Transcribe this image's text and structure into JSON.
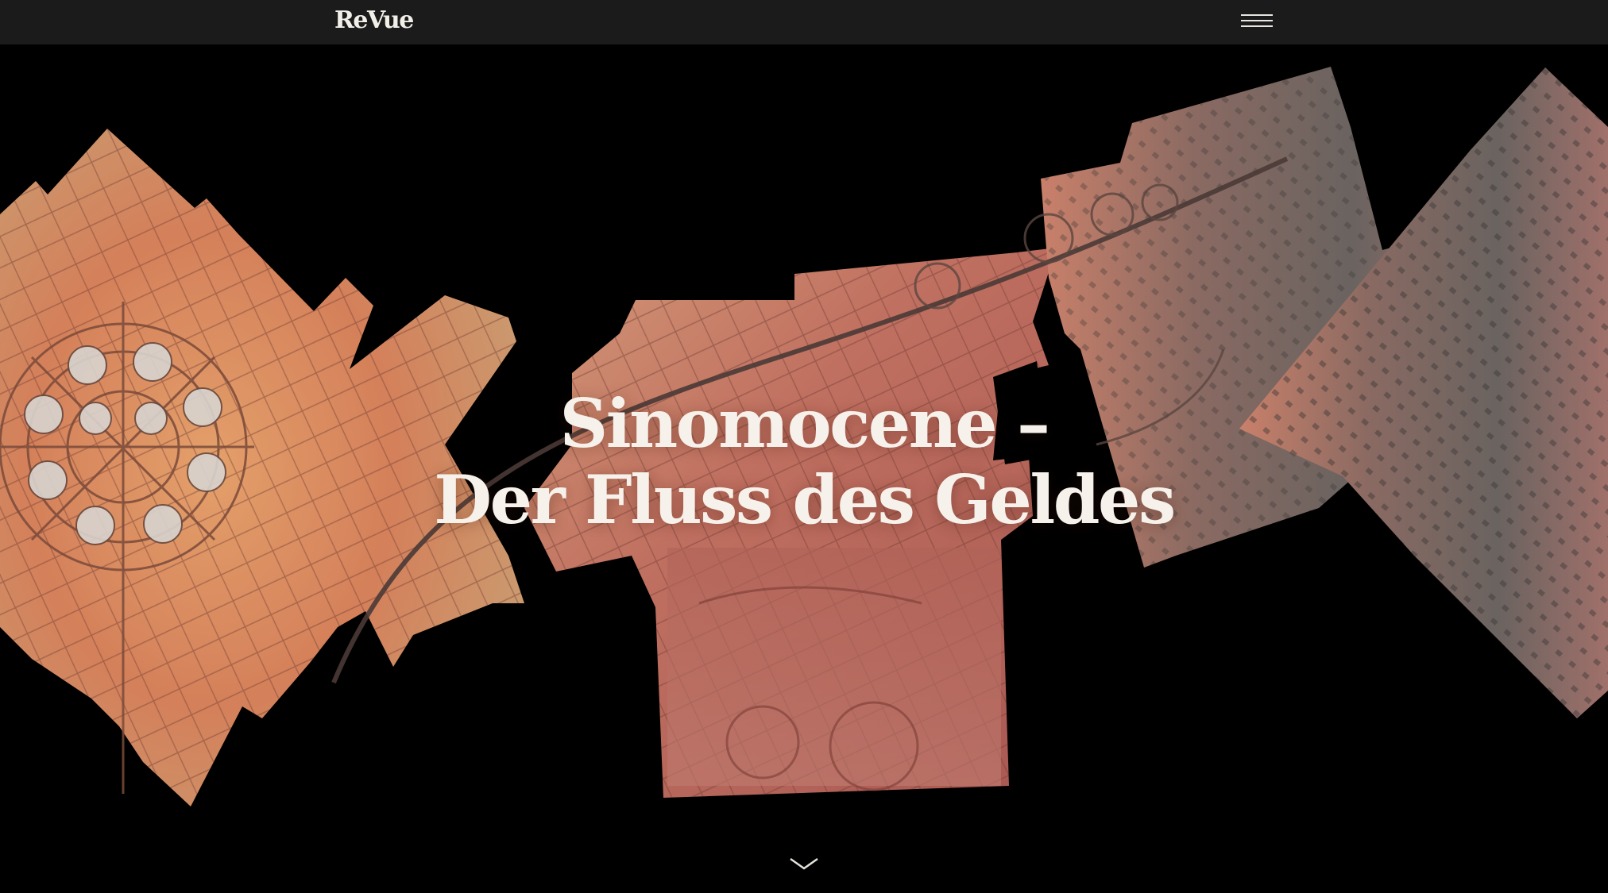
{
  "header": {
    "logo": "ReVue",
    "menu_icon": "hamburger-menu-icon"
  },
  "hero": {
    "title_line_1": "Sinomocene –",
    "title_line_2": "Der Fluss des Geldes",
    "scroll_icon": "chevron-down-icon"
  },
  "colors": {
    "background": "#000000",
    "topbar": "#1b1b1b",
    "title_text": "#f6f1ea",
    "terrain_orange": "#d98a5a",
    "terrain_sand": "#e0b07a",
    "terrain_red": "#b8544a",
    "terrain_grey": "#6e6763"
  }
}
